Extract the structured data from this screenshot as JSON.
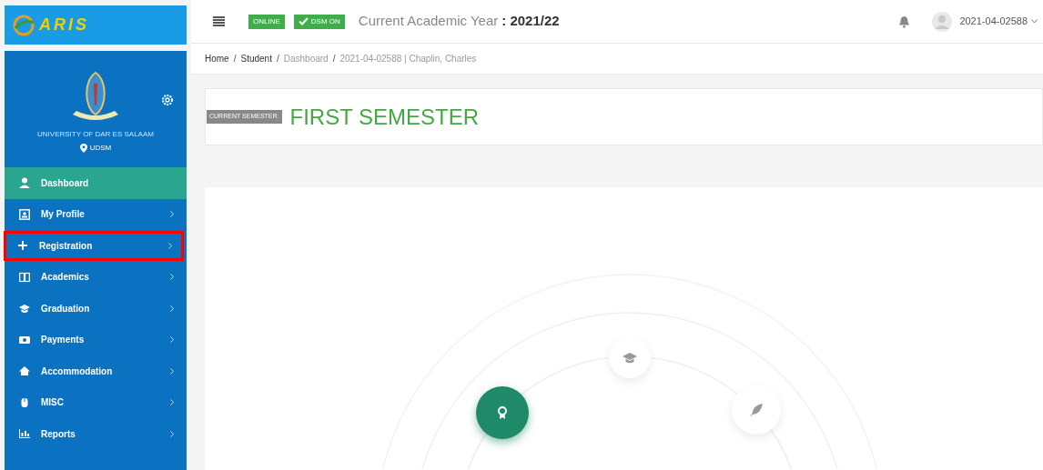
{
  "brand": {
    "logo_text": "ARIS"
  },
  "topbar": {
    "badges": [
      "ONLINE",
      "DSM ON"
    ],
    "year_label": "Current Academic Year",
    "year_value": ": 2021/22",
    "user": "2021-04-02588"
  },
  "profile": {
    "institution": "UNIVERSITY OF DAR ES SALAAM",
    "campus": "UDSM"
  },
  "sidebar": {
    "items": [
      {
        "label": "Dashboard",
        "kind": "dashboard",
        "selected": true,
        "highlighted": false,
        "has_arrow": false
      },
      {
        "label": "My Profile",
        "kind": "profile",
        "selected": false,
        "highlighted": false,
        "has_arrow": true
      },
      {
        "label": "Registration",
        "kind": "registration",
        "selected": false,
        "highlighted": true,
        "has_arrow": true
      },
      {
        "label": "Academics",
        "kind": "academics",
        "selected": false,
        "highlighted": false,
        "has_arrow": true
      },
      {
        "label": "Graduation",
        "kind": "graduation",
        "selected": false,
        "highlighted": false,
        "has_arrow": true
      },
      {
        "label": "Payments",
        "kind": "payments",
        "selected": false,
        "highlighted": false,
        "has_arrow": true
      },
      {
        "label": "Accommodation",
        "kind": "accommodation",
        "selected": false,
        "highlighted": false,
        "has_arrow": true
      },
      {
        "label": "MISC",
        "kind": "misc",
        "selected": false,
        "highlighted": false,
        "has_arrow": true
      },
      {
        "label": "Reports",
        "kind": "reports",
        "selected": false,
        "highlighted": false,
        "has_arrow": true
      }
    ]
  },
  "breadcrumb_separator": "/",
  "breadcrumb": [
    {
      "label": "Home",
      "current": false
    },
    {
      "label": "Student",
      "current": false
    },
    {
      "label": "Dashboard",
      "current": true
    },
    {
      "label": "2021-04-02588 | Chaplin, Charles",
      "current": true
    }
  ],
  "semester": {
    "tag": "CURRENT SEMESTER:",
    "value": "FIRST SEMESTER"
  },
  "timeline": {
    "nodes": [
      {
        "kind": "award",
        "selected": true
      },
      {
        "kind": "graduation",
        "selected": false
      },
      {
        "kind": "feather",
        "selected": false
      }
    ]
  }
}
